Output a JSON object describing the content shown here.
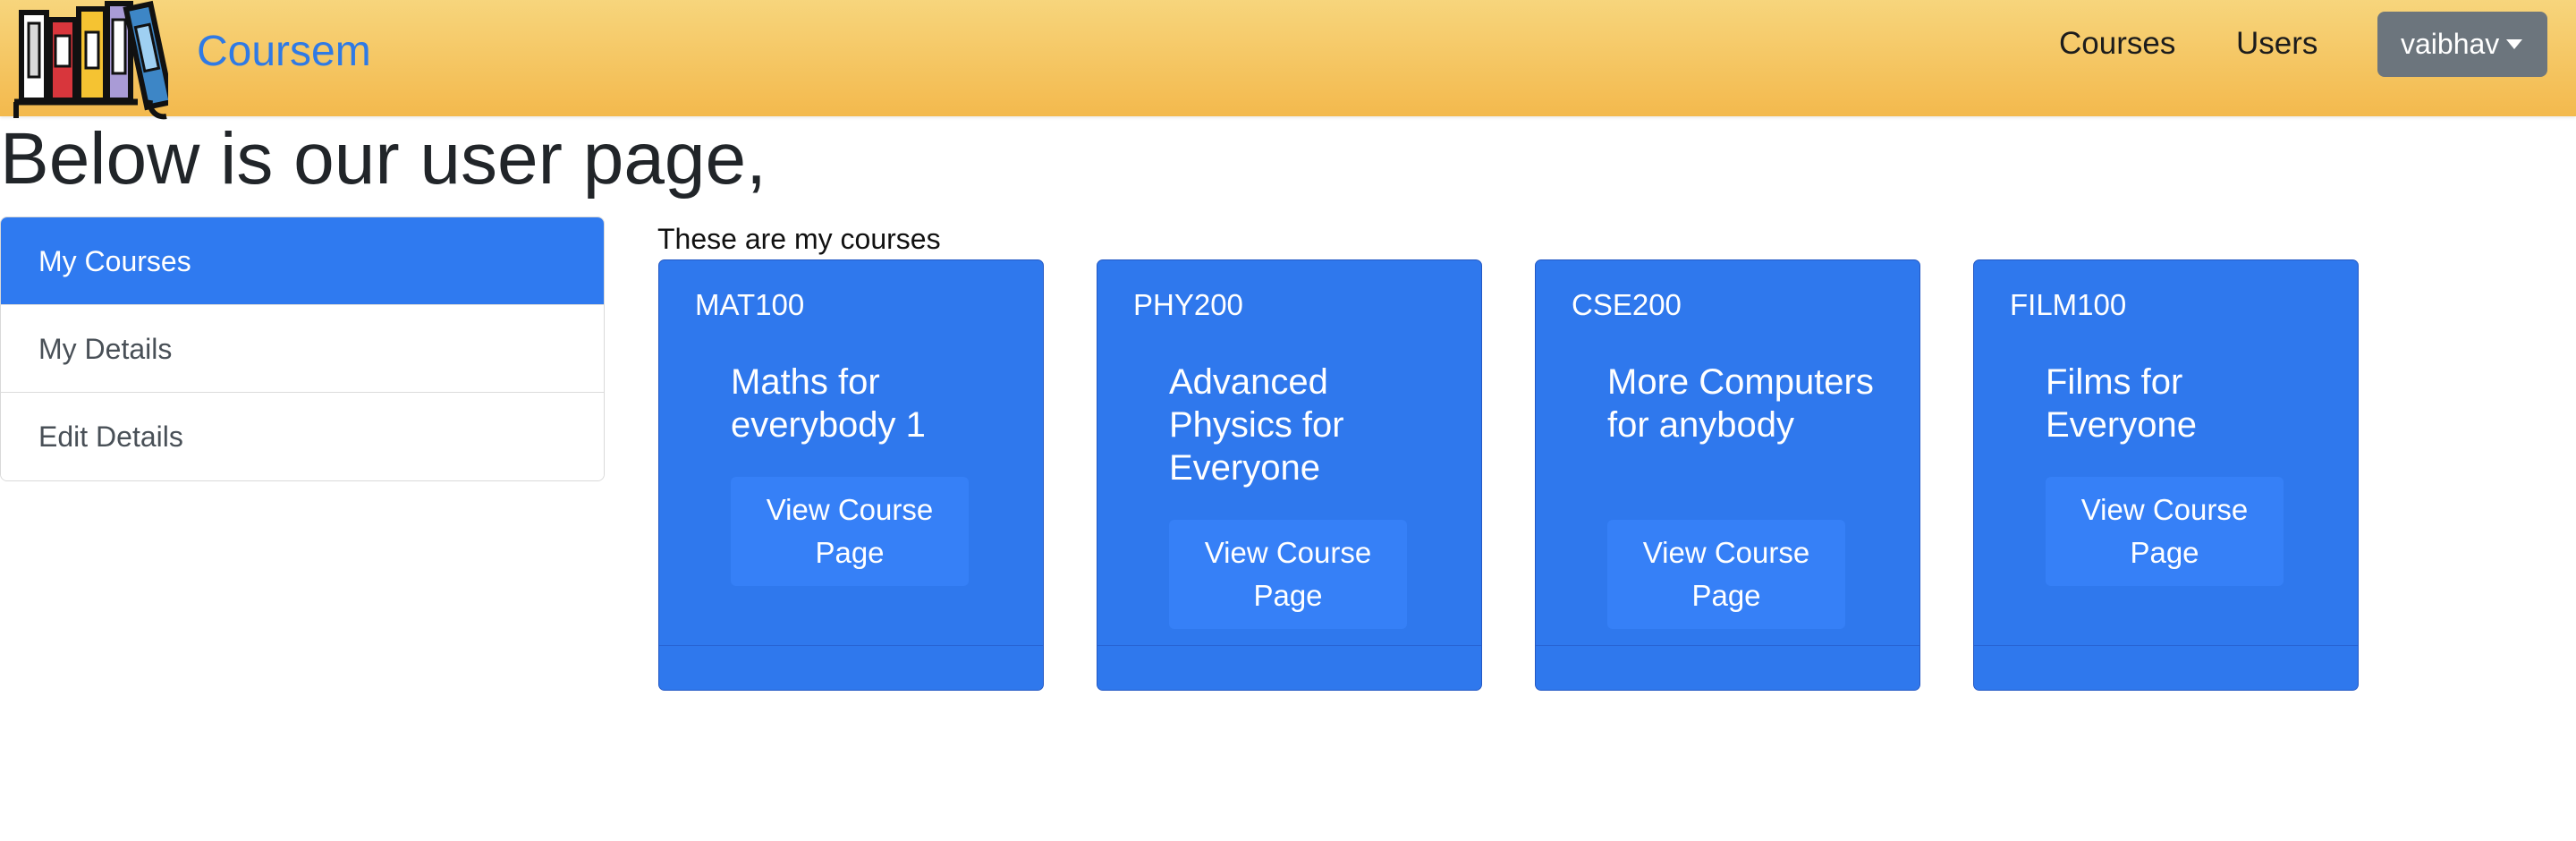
{
  "navbar": {
    "brand": "Coursem",
    "links": [
      {
        "label": "Courses"
      },
      {
        "label": "Users"
      }
    ],
    "user_menu": {
      "label": "vaibhav"
    }
  },
  "page": {
    "heading": "Below is our user page,"
  },
  "sidebar": {
    "items": [
      {
        "label": "My Courses",
        "active": true
      },
      {
        "label": "My Details",
        "active": false
      },
      {
        "label": "Edit Details",
        "active": false
      }
    ]
  },
  "courses": {
    "caption": "These are my courses",
    "cards": [
      {
        "code": "MAT100",
        "title": "Maths for everybody 1",
        "button": "View Course Page"
      },
      {
        "code": "PHY200",
        "title": "Advanced Physics for Everyone",
        "button": "View Course Page"
      },
      {
        "code": "CSE200",
        "title": "More Computers for anybody",
        "button": "View Course Page"
      },
      {
        "code": "FILM100",
        "title": "Films for Everyone",
        "button": "View Course Page"
      }
    ]
  },
  "colors": {
    "navbar_top": "#f7d57c",
    "navbar_bottom": "#f3b94d",
    "brand": "#2f7ae5",
    "primary": "#2f78ed",
    "user_button": "#6c757d"
  },
  "icons": {
    "logo": "books-logo-icon",
    "dropdown": "caret-down-icon"
  }
}
